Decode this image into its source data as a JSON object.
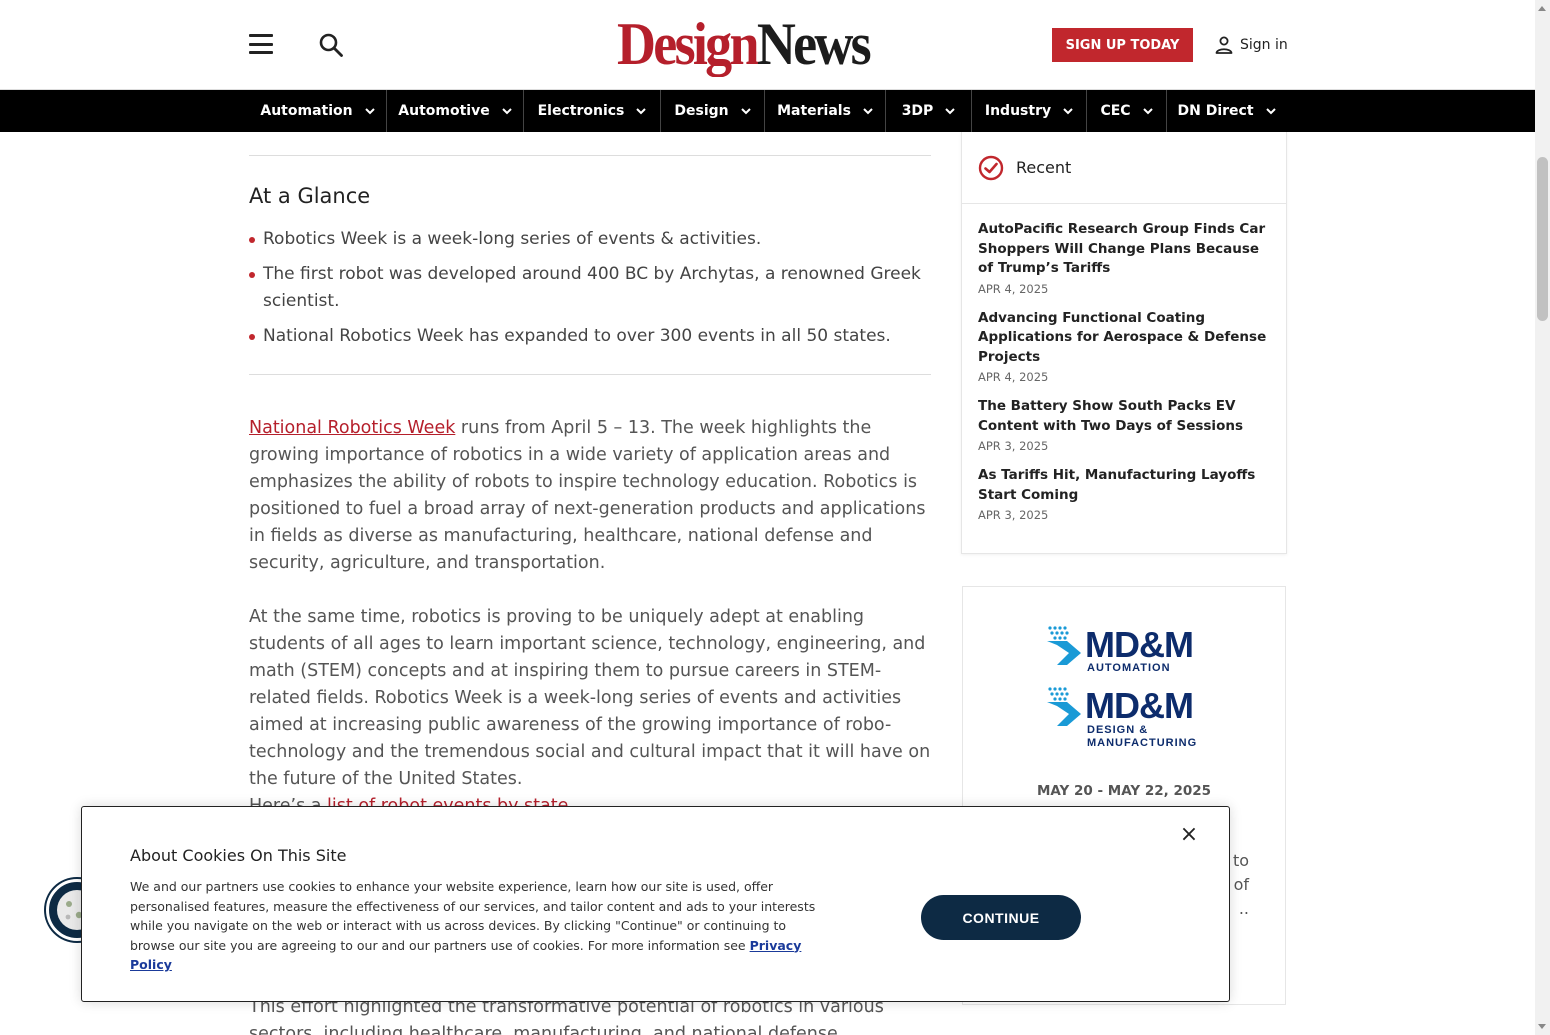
{
  "header": {
    "logo_part1": "Design",
    "logo_part2": "News",
    "signup_label": "SIGN UP TODAY",
    "signin_label": "Sign in"
  },
  "nav": {
    "items": [
      {
        "label": "Automation"
      },
      {
        "label": "Automotive"
      },
      {
        "label": "Electronics"
      },
      {
        "label": "Design"
      },
      {
        "label": "Materials"
      },
      {
        "label": "3DP"
      },
      {
        "label": "Industry"
      },
      {
        "label": "CEC"
      },
      {
        "label": "DN Direct"
      }
    ]
  },
  "article": {
    "glance_title": "At a Glance",
    "glance_items": [
      "Robotics Week is a week-long series of events & activities.",
      "The first robot was developed around 400 BC by Archytas, a renowned Greek scientist.",
      "National Robotics Week has expanded to over 300 events in all 50 states."
    ],
    "p1_link": "National Robotics Week",
    "p1_text": " runs from April 5 – 13. The week highlights the growing importance of robotics in a wide variety of application areas and emphasizes the ability of robots to inspire technology education. Robotics is positioned to fuel a broad array of next-generation products and applications in fields as diverse as manufacturing, healthcare, national defense and security, agriculture, and transportation.",
    "p2_text": "At the same time, robotics is proving to be uniquely adept at enabling students of all ages to learn important science, technology, engineering, and math (STEM) concepts and at inspiring them to pursue careers in STEM-related fields. Robotics Week is a week-long series of events and activities aimed at increasing public awareness of the growing importance of robo-technology and the tremendous social and cultural impact that it will have on the future of the United States.",
    "p3_text": "Here’s a ",
    "p3_link": "list of robot events by state",
    "p3_end": ".",
    "p4_text": "This effort highlighted the transformative potential of robotics in various sectors, including healthcare, manufacturing, and national defense."
  },
  "sidebar": {
    "recent_title": "Recent",
    "recent_items": [
      {
        "headline": "AutoPacific Research Group Finds Car Shoppers Will Change Plans Because of Trump’s Tariffs",
        "date": "APR 4, 2025"
      },
      {
        "headline": "Advancing Functional Coating Applications for Aerospace & Defense Projects",
        "date": "APR 4, 2025"
      },
      {
        "headline": "The Battery Show South Packs EV Content with Two Days of Sessions",
        "date": "APR 3, 2025"
      },
      {
        "headline": "As Tariffs Hit, Manufacturing Layoffs Start Coming",
        "date": "APR 3, 2025"
      }
    ],
    "ad": {
      "logo1_name": "MD&M",
      "logo1_sub": "AUTOMATION",
      "logo2_name": "MD&M",
      "logo2_sub_line1": "DESIGN &",
      "logo2_sub_line2": "MANUFACTURING",
      "dates": "MAY 20 - MAY 22, 2025",
      "frag1": "l to",
      "frag2": "of",
      "frag3": ".."
    }
  },
  "cookie": {
    "title": "About Cookies On This Site",
    "body": "We and our partners use cookies to enhance your website experience, learn how our site is used, offer personalised features, measure the effectiveness of our services, and tailor content and ads to your interests while you navigate on the web or interact with us across devices. By clicking \"Continue\" or continuing to browse our site you are agreeing to our and our partners use of cookies. For more information see ",
    "policy_link": "Privacy Policy",
    "continue_label": "CONTINUE",
    "close_glyph": "×"
  },
  "colors": {
    "brand_red": "#c1272d",
    "nav_bg": "#000000",
    "cookie_navy": "#0d2a44",
    "mdm_blue": "#0d2c6c"
  },
  "icons": [
    "menu-icon",
    "search-icon",
    "user-icon",
    "chevron-down-icon",
    "check-circle-icon",
    "close-icon",
    "cookie-icon"
  ]
}
